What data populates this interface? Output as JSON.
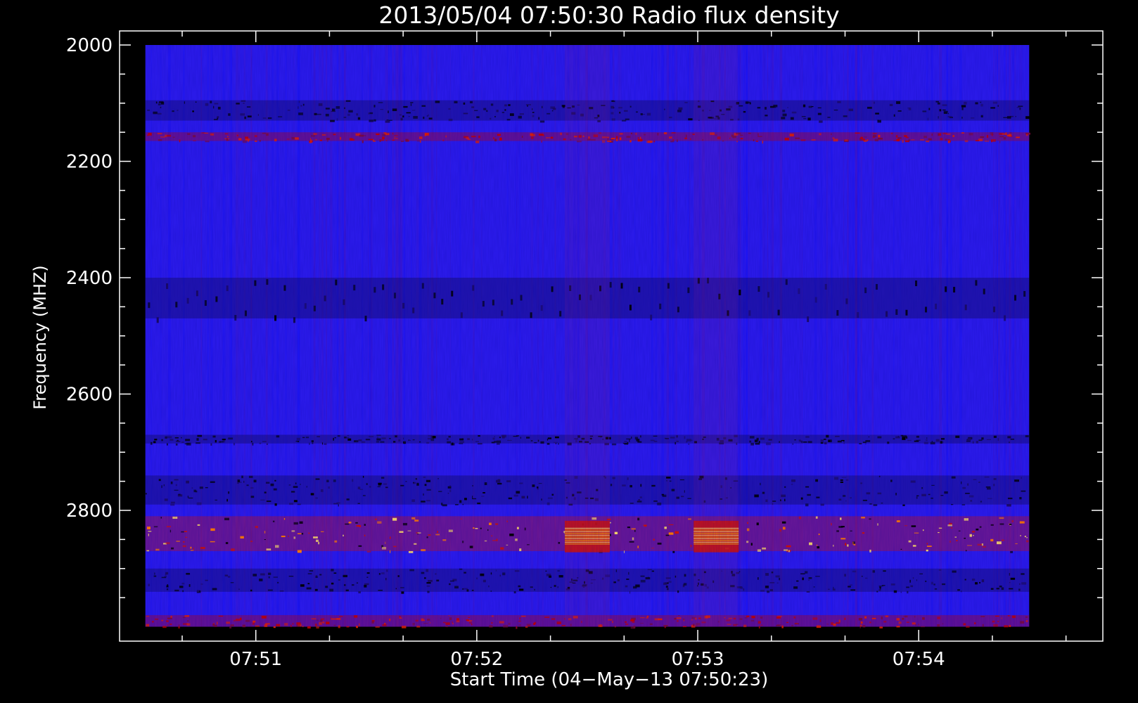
{
  "chart_data": {
    "type": "heatmap",
    "title": "2013/05/04 07:50:30 Radio flux density",
    "xlabel": "Start Time (04−May−13 07:50:23)",
    "ylabel": "Frequency (MHZ)",
    "x_ticks": [
      "07:51",
      "07:52",
      "07:53",
      "07:54"
    ],
    "y_ticks": [
      "2000",
      "2200",
      "2400",
      "2600",
      "2800"
    ],
    "y_range_mhz": [
      2000,
      3000
    ],
    "x_range": [
      "07:50:23",
      "07:54:50"
    ],
    "data_extent": {
      "time": [
        "07:50:30",
        "07:54:30"
      ],
      "freq_mhz": [
        2000,
        3000
      ]
    },
    "y_direction": "increasing downward",
    "colormap": [
      "#000000",
      "#1010ff",
      "#cc0000",
      "#ffe066"
    ],
    "background_color": "#2a1ae8",
    "features": [
      {
        "type": "band",
        "freq_mhz": [
          2095,
          2130
        ],
        "level": "dark",
        "note": "interference lines"
      },
      {
        "type": "band",
        "freq_mhz": [
          2150,
          2165
        ],
        "level": "red"
      },
      {
        "type": "band",
        "freq_mhz": [
          2400,
          2470
        ],
        "level": "dark",
        "note": "periodic dashes"
      },
      {
        "type": "band",
        "freq_mhz": [
          2670,
          2685
        ],
        "level": "dark"
      },
      {
        "type": "band",
        "freq_mhz": [
          2740,
          2790
        ],
        "level": "dark"
      },
      {
        "type": "band",
        "freq_mhz": [
          2810,
          2870
        ],
        "level": "red-yellow",
        "note": "strongest emission"
      },
      {
        "type": "band",
        "freq_mhz": [
          2900,
          2940
        ],
        "level": "dark"
      },
      {
        "type": "band",
        "freq_mhz": [
          2980,
          3000
        ],
        "level": "red"
      },
      {
        "type": "peak",
        "time": "07:52:30",
        "freq_mhz": [
          2830,
          2860
        ],
        "level": "yellow"
      },
      {
        "type": "peak",
        "time": "07:53:05",
        "freq_mhz": [
          2830,
          2860
        ],
        "level": "yellow"
      }
    ]
  }
}
